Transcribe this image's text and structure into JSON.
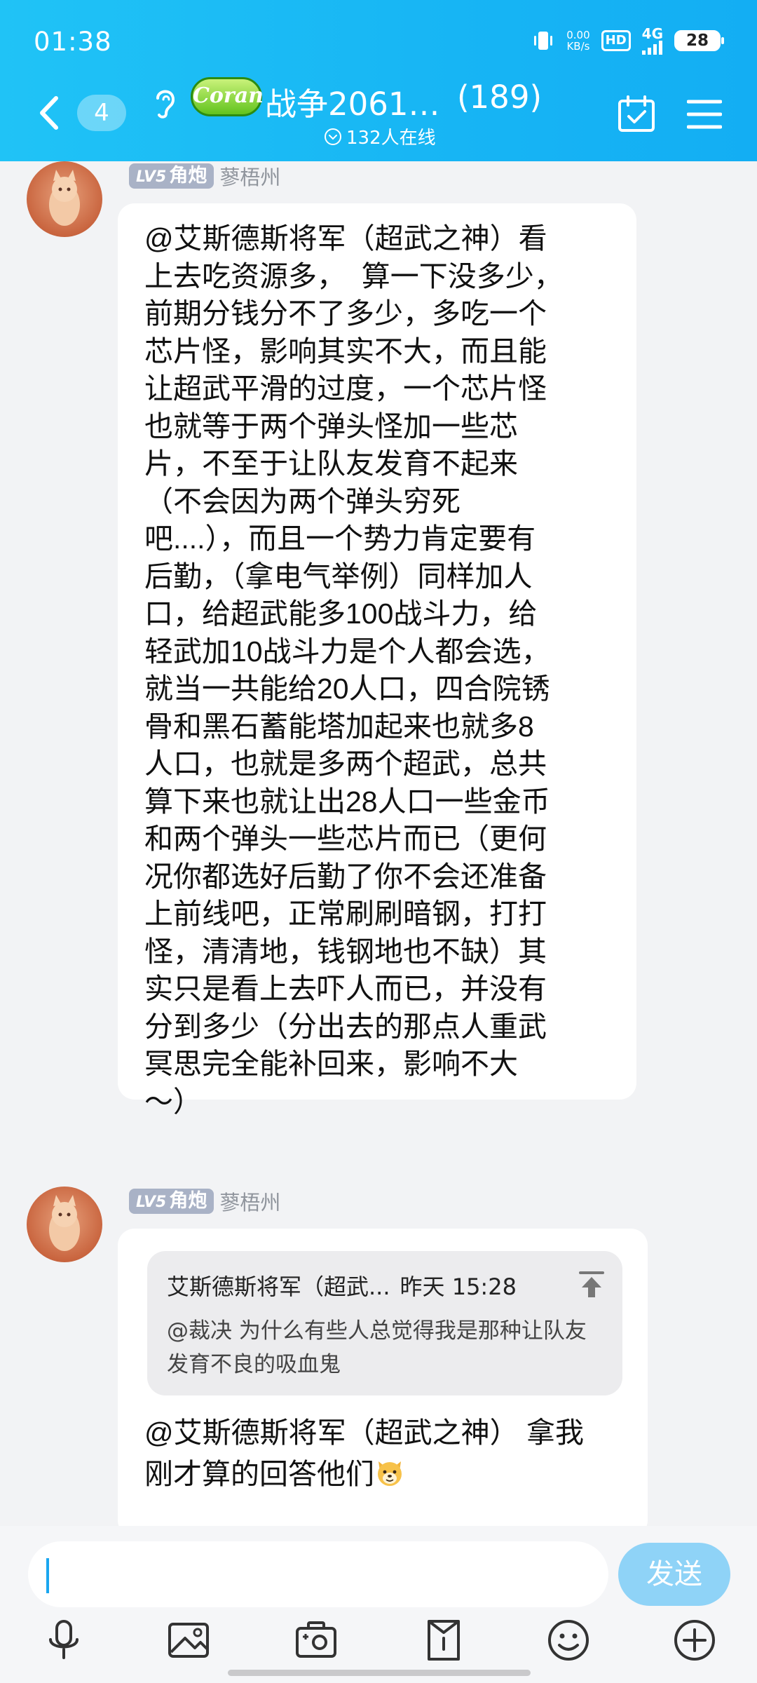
{
  "status_bar": {
    "time": "01:38",
    "speed_value": "0.00",
    "speed_unit": "KB/s",
    "hd": "HD",
    "network": "4G",
    "battery": "28"
  },
  "header": {
    "unread": "4",
    "logo_text": "Coran",
    "title": "战争2061…",
    "member_count": "(189)",
    "online": "132人在线"
  },
  "messages": [
    {
      "level": "LV5",
      "title_badge": "角炮",
      "sender": "蓼梧州",
      "text": "@艾斯德斯将军（超武之神）看\n上去吃资源多，  算一下没多少，\n前期分钱分不了多少，多吃一个\n芯片怪，影响其实不大，而且能\n让超武平滑的过度，一个芯片怪\n也就等于两个弹头怪加一些芯\n片，不至于让队友发育不起来\n（不会因为两个弹头穷死\n吧....），而且一个势力肯定要有\n后勤，（拿电气举例）同样加人\n口，给超武能多100战斗力，给\n轻武加10战斗力是个人都会选，\n就当一共能给20人口，四合院锈\n骨和黑石蓄能塔加起来也就多8\n人口，也就是多两个超武，总共\n算下来也就让出28人口一些金币\n和两个弹头一些芯片而已（更何\n况你都选好后勤了你不会还准备\n上前线吧，正常刷刷暗钢，打打\n怪，清清地，钱钢地也不缺）其\n实只是看上去吓人而已，并没有\n分到多少（分出去的那点人重武\n冥思完全能补回来，影响不大\n～）"
    },
    {
      "level": "LV5",
      "title_badge": "角炮",
      "sender": "蓼梧州",
      "quote": {
        "author": "艾斯德斯将军（超武...",
        "time": "昨天 15:28",
        "text": "@裁决 为什么有些人总觉得我是那种让队友发育不良的吸血鬼"
      },
      "text": "@艾斯德斯将军（超武之神） 拿我刚才算的回答他们"
    }
  ],
  "input": {
    "placeholder": "",
    "send_label": "发送"
  },
  "toolbar": [
    "mic-icon",
    "image-icon",
    "camera-icon",
    "file-icon",
    "emoji-icon",
    "plus-icon"
  ]
}
